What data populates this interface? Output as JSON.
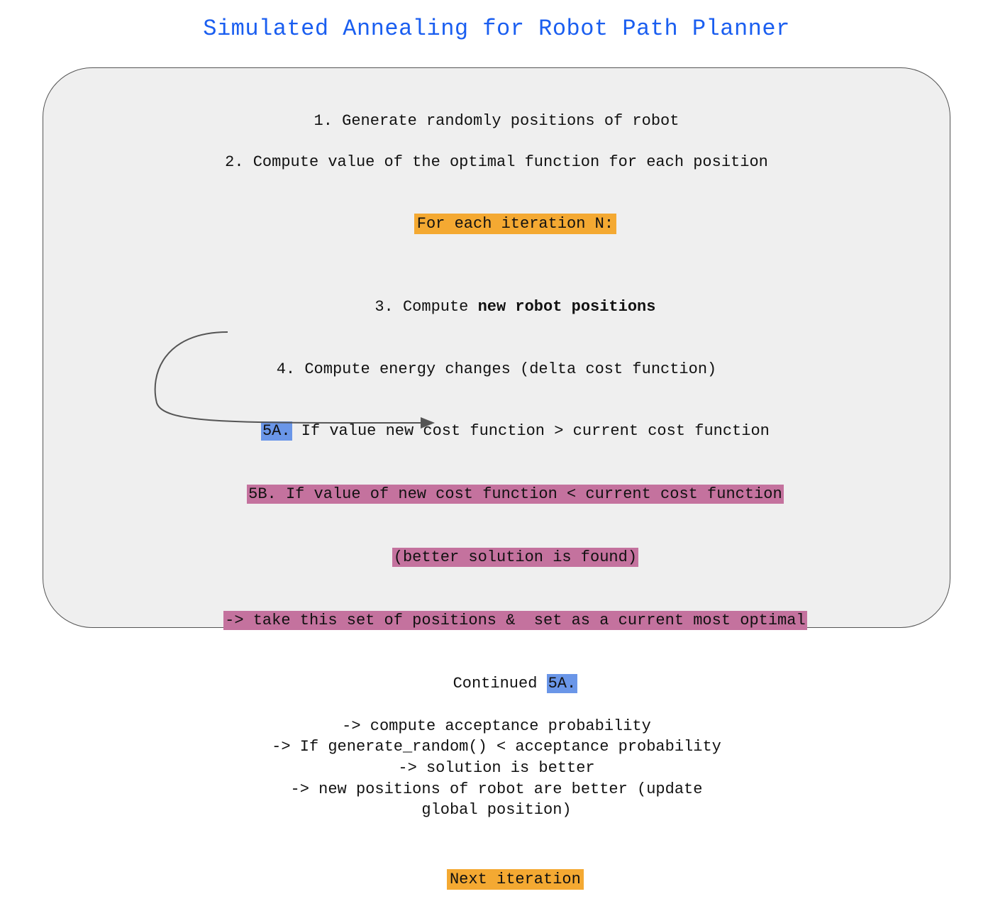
{
  "title": "Simulated Annealing for Robot Path Planner",
  "step1": "1. Generate randomly positions of robot",
  "step2": "2. Compute value of the optimal function for each position",
  "loop_header": "For each iteration N:",
  "step3_prefix": "3. Compute ",
  "step3_bold": "new robot positions",
  "step4": "4. Compute energy changes (delta cost function)",
  "step5a_tag": "5A.",
  "step5a_rest": " If value new cost function > current cost function",
  "step5b_line1": "5B. If value of new cost function < current cost function",
  "step5b_line2": "(better solution is found)",
  "step5b_line3": "-> take this set of positions &  set as a current most optimal",
  "cont_prefix": "Continued ",
  "cont_tag": "5A.",
  "sub1": "-> compute acceptance probability",
  "sub2": "-> If generate_random() < acceptance probability",
  "sub3": "-> solution is better",
  "sub4": "-> new positions of robot are better (update",
  "sub5": "global position)",
  "next_iter": "Next iteration",
  "colors": {
    "title_blue": "#1a5ef0",
    "highlight_orange": "#f4a932",
    "highlight_blue": "#6a96e8",
    "highlight_pink": "#c4729e",
    "panel_bg": "#efefef"
  }
}
